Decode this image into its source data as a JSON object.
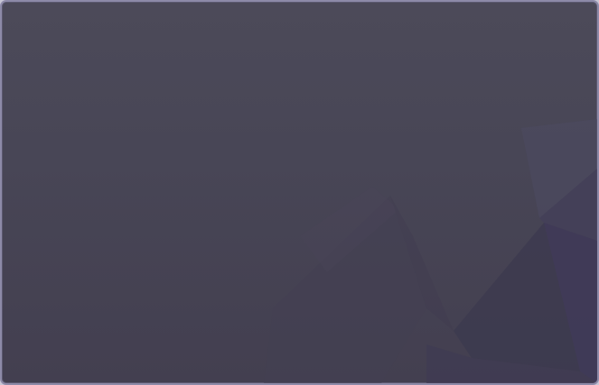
{
  "screen": {
    "content_visible": false
  },
  "colors": {
    "frame_border": "#8d8aa8",
    "background_top": "#4c4a59",
    "background_bottom": "#433f50",
    "accent_facet": "#3d3a57"
  }
}
